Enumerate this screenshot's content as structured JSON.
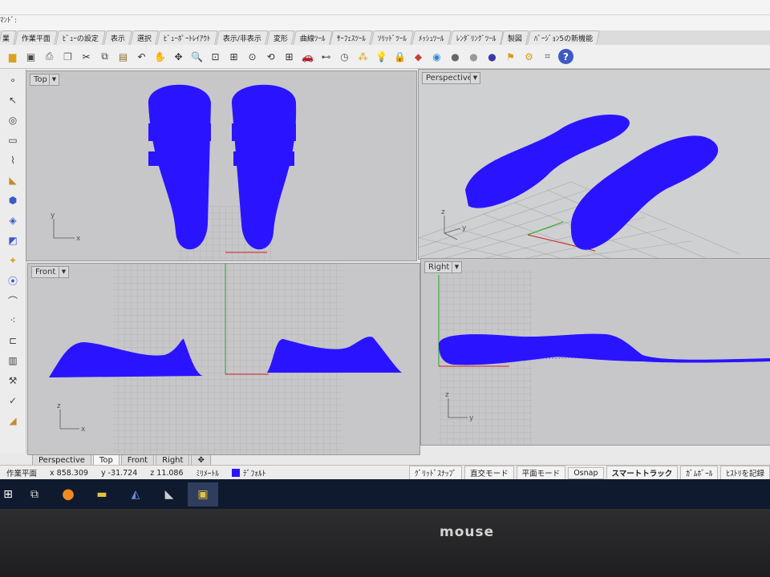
{
  "command": {
    "prompt": "ﾏﾝﾄﾞ:"
  },
  "ribbon_tabs": [
    "作業平面",
    "ﾋﾞｭｰの設定",
    "表示",
    "選択",
    "ﾋﾞｭｰﾎﾟｰﾄﾚｲｱｳﾄ",
    "表示/非表示",
    "変形",
    "曲線ﾂｰﾙ",
    "ｻｰﾌｪｽﾂｰﾙ",
    "ｿﾘｯﾄﾞﾂｰﾙ",
    "ﾒｯｼｭﾂｰﾙ",
    "ﾚﾝﾀﾞﾘﾝｸﾞﾂｰﾙ",
    "製図",
    "ﾊﾞｰｼﾞｮﾝ5の新機能"
  ],
  "viewports": {
    "top": "Top",
    "perspective": "Perspective",
    "front": "Front",
    "right": "Right"
  },
  "axis_labels": {
    "x": "x",
    "y": "y",
    "z": "z"
  },
  "viewport_tabs": [
    "Perspective",
    "Top",
    "Front",
    "Right"
  ],
  "status": {
    "plane": "作業平面",
    "x": "x 858.309",
    "y": "y -31.724",
    "z": "z 11.086",
    "units": "ﾐﾘﾒｰﾄﾙ",
    "layer": "ﾃﾞﾌｫﾙﾄ",
    "buttons": [
      "ｸﾞﾘｯﾄﾞｽﾅｯﾌﾟ",
      "直交モード",
      "平面モード",
      "Osnap",
      "スマートトラック",
      "ｶﾞﾑﾎﾞｰﾙ",
      "ﾋｽﾄﾘを記録"
    ]
  },
  "laptop_brand": "mouse",
  "colors": {
    "mesh": "#2a14ff",
    "grid_line": "#a3a3a5",
    "x_axis": "#cc2222",
    "y_axis": "#22aa22"
  }
}
